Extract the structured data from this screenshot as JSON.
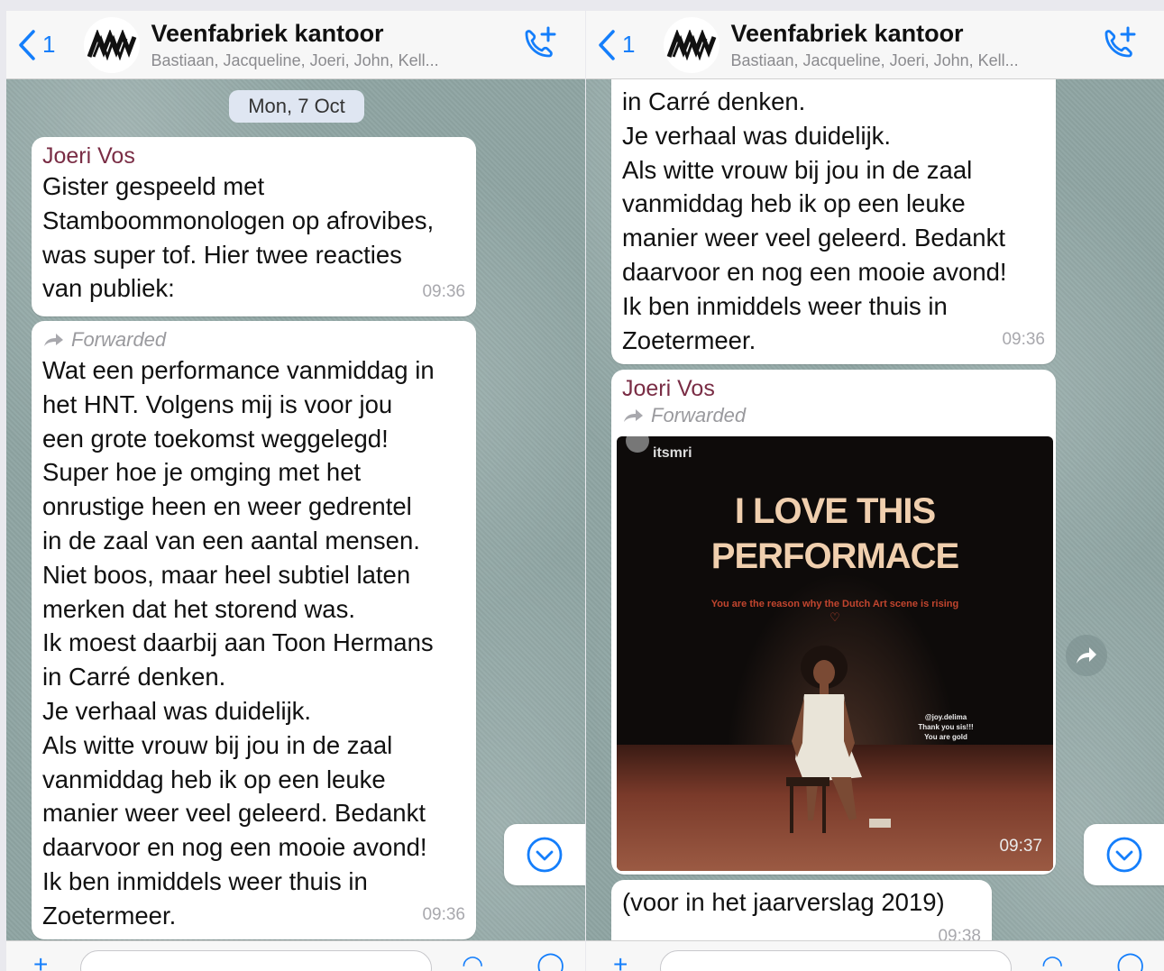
{
  "header": {
    "back_count": "1",
    "title": "Veenfabriek kantoor",
    "subtitle": "Bastiaan, Jacqueline, Joeri, John, Kell..."
  },
  "left": {
    "date_pill": "Mon, 7 Oct",
    "msg1": {
      "sender": "Joeri Vos",
      "text": "Gister gespeeld met\nStamboommonologen op afrovibes,\nwas super tof. Hier twee reacties\nvan publiek:",
      "time": "09:36"
    },
    "msg2": {
      "forwarded": "Forwarded",
      "text": "Wat een performance vanmiddag in\nhet HNT. Volgens mij is voor jou\neen grote toekomst weggelegd!\nSuper hoe je omging met het\nonrustige heen en weer gedrentel\nin de zaal van een aantal mensen.\nNiet boos, maar heel subtiel laten\nmerken dat het storend was.\nIk moest daarbij aan Toon Hermans\nin Carré denken.\nJe verhaal was duidelijk.\nAls witte vrouw bij jou in de zaal\nvanmiddag heb ik  op een leuke\nmanier weer veel geleerd. Bedankt\ndaarvoor en nog een mooie avond!\nIk ben inmiddels weer thuis in\nZoetermeer.",
      "time": "09:36"
    }
  },
  "right": {
    "msg_cont": {
      "text": "in Carré denken.\nJe verhaal was duidelijk.\nAls witte vrouw bij jou in de zaal\nvanmiddag heb ik  op een leuke\nmanier weer veel geleerd. Bedankt\ndaarvoor en nog een mooie avond!\nIk ben inmiddels weer thuis in\nZoetermeer.",
      "time": "09:36"
    },
    "msg_img": {
      "sender": "Joeri Vos",
      "forwarded": "Forwarded",
      "image": {
        "handle": "itsmri",
        "title_line1": "I LOVE THIS",
        "title_line2": "PERFORMACE",
        "subtitle": "You are the reason why the Dutch Art scene is rising",
        "heart": "♡",
        "tag_line1": "@joy.delima",
        "tag_line2": "Thank you sis!!!",
        "tag_line3": "You are gold"
      },
      "time": "09:37"
    },
    "msg_caption": {
      "text": "(voor in het jaarverslag 2019)",
      "time": "09:38"
    }
  },
  "colors": {
    "accent": "#147efb",
    "sender": "#7a2d45",
    "wallpaper": "#8fa5a3"
  },
  "icons": {
    "back": "chevron-left-icon",
    "call": "add-call-icon",
    "scroll": "chevron-down-circle-icon",
    "share": "share-arrow-icon",
    "forward": "forward-arrow-icon"
  }
}
